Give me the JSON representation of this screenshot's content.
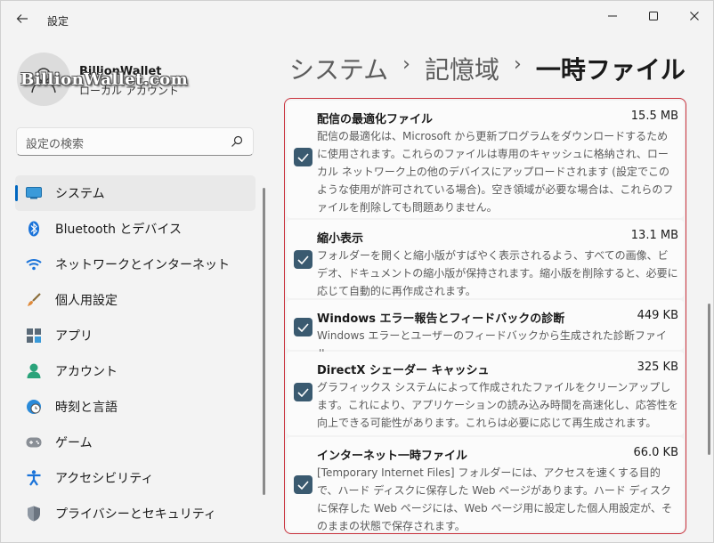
{
  "window": {
    "title": "設定",
    "back_icon": "back-arrow-icon",
    "controls": [
      "minimize-icon",
      "maximize-icon",
      "close-icon"
    ]
  },
  "profile": {
    "name": "BillionWallet",
    "account_type": "ローカル アカウント",
    "watermark": "BillionWallet.com"
  },
  "search": {
    "placeholder": "設定の検索",
    "icon": "search-icon"
  },
  "sidebar": {
    "items": [
      {
        "label": "システム",
        "icon": "system-icon",
        "active": true
      },
      {
        "label": "Bluetooth とデバイス",
        "icon": "bluetooth-icon"
      },
      {
        "label": "ネットワークとインターネット",
        "icon": "wifi-icon"
      },
      {
        "label": "個人用設定",
        "icon": "brush-icon"
      },
      {
        "label": "アプリ",
        "icon": "apps-icon"
      },
      {
        "label": "アカウント",
        "icon": "account-icon"
      },
      {
        "label": "時刻と言語",
        "icon": "clock-globe-icon"
      },
      {
        "label": "ゲーム",
        "icon": "gamepad-icon"
      },
      {
        "label": "アクセシビリティ",
        "icon": "accessibility-icon"
      },
      {
        "label": "プライバシーとセキュリティ",
        "icon": "shield-icon"
      }
    ]
  },
  "breadcrumb": {
    "items": [
      "システム",
      "記憶域",
      "一時ファイル"
    ],
    "separator": "›"
  },
  "files": [
    {
      "title": "配信の最適化ファイル",
      "size": "15.5 MB",
      "checked": true,
      "description": "配信の最適化は、Microsoft から更新プログラムをダウンロードするために使用されます。これらのファイルは専用のキャッシュに格納され、ローカル ネットワーク上の他のデバイスにアップロードされます (設定でこのような使用が許可されている場合)。空き領域が必要な場合は、これらのファイルを削除しても問題ありません。"
    },
    {
      "title": "縮小表示",
      "size": "13.1 MB",
      "checked": true,
      "description": "フォルダーを開くと縮小版がすばやく表示されるよう、すべての画像、ビデオ、ドキュメントの縮小版が保持されます。縮小版を削除すると、必要に応じて自動的に再作成されます。"
    },
    {
      "title": "Windows エラー報告とフィードバックの診断",
      "size": "449 KB",
      "checked": true,
      "description": "Windows エラーとユーザーのフィードバックから生成された診断ファイル。"
    },
    {
      "title": "DirectX シェーダー キャッシュ",
      "size": "325 KB",
      "checked": true,
      "description": "グラフィックス システムによって作成されたファイルをクリーンアップします。これにより、アプリケーションの読み込み時間を高速化し、応答性を向上できる可能性があります。これらは必要に応じて再生成されます。"
    },
    {
      "title": "インターネット一時ファイル",
      "size": "66.0 KB",
      "checked": true,
      "description": "[Temporary Internet Files] フォルダーには、アクセスを速くする目的で、ハード ディスクに保存した Web ページがあります。ハード ディスクに保存した Web ページには、Web ページ用に設定した個人用設定が、そのままの状態で保存されます。"
    }
  ],
  "colors": {
    "accent": "#0067c0",
    "checkbox": "#3a5a70",
    "highlight_border": "#c8303b"
  }
}
